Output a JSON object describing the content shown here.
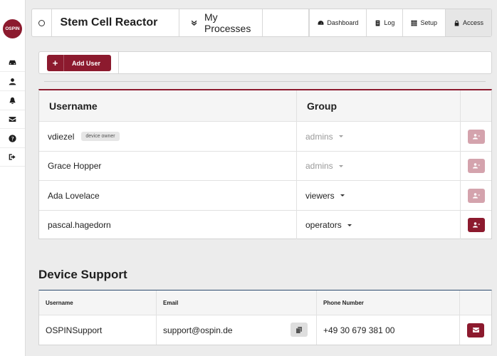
{
  "brand": {
    "logo_text": "OSPIN"
  },
  "sidebar": {
    "items": [
      {
        "icon": "device-icon"
      },
      {
        "icon": "user-icon"
      },
      {
        "icon": "bell-icon"
      },
      {
        "icon": "envelope-icon"
      },
      {
        "icon": "help-icon"
      },
      {
        "icon": "sign-out-icon"
      }
    ]
  },
  "topbar": {
    "device_name": "Stem Cell Reactor",
    "processes_label": "My Processes",
    "nav": [
      {
        "label": "Dashboard",
        "icon": "dashboard-icon"
      },
      {
        "label": "Log",
        "icon": "log-icon"
      },
      {
        "label": "Setup",
        "icon": "grid-icon"
      },
      {
        "label": "Access",
        "icon": "lock-icon",
        "active": true
      }
    ]
  },
  "users": {
    "add_button_label": "Add User",
    "columns": [
      "Username",
      "Group"
    ],
    "rows": [
      {
        "username": "vdiezel",
        "badge": "device owner",
        "group": "admins",
        "group_disabled": true,
        "action_enabled": false
      },
      {
        "username": "Grace Hopper",
        "badge": "",
        "group": "admins",
        "group_disabled": true,
        "action_enabled": false
      },
      {
        "username": "Ada Lovelace",
        "badge": "",
        "group": "viewers",
        "group_disabled": false,
        "action_enabled": false
      },
      {
        "username": "pascal.hagedorn",
        "badge": "",
        "group": "operators",
        "group_disabled": false,
        "action_enabled": true
      }
    ]
  },
  "support": {
    "title": "Device Support",
    "columns": [
      "Username",
      "Email",
      "Phone Number"
    ],
    "row": {
      "username": "OSPINSupport",
      "email": "support@ospin.de",
      "phone": "+49 30 679 381 00"
    }
  },
  "colors": {
    "accent": "#8c1a2e",
    "accent_disabled": "#d4a3ad",
    "support_border": "#2c4a6e"
  }
}
